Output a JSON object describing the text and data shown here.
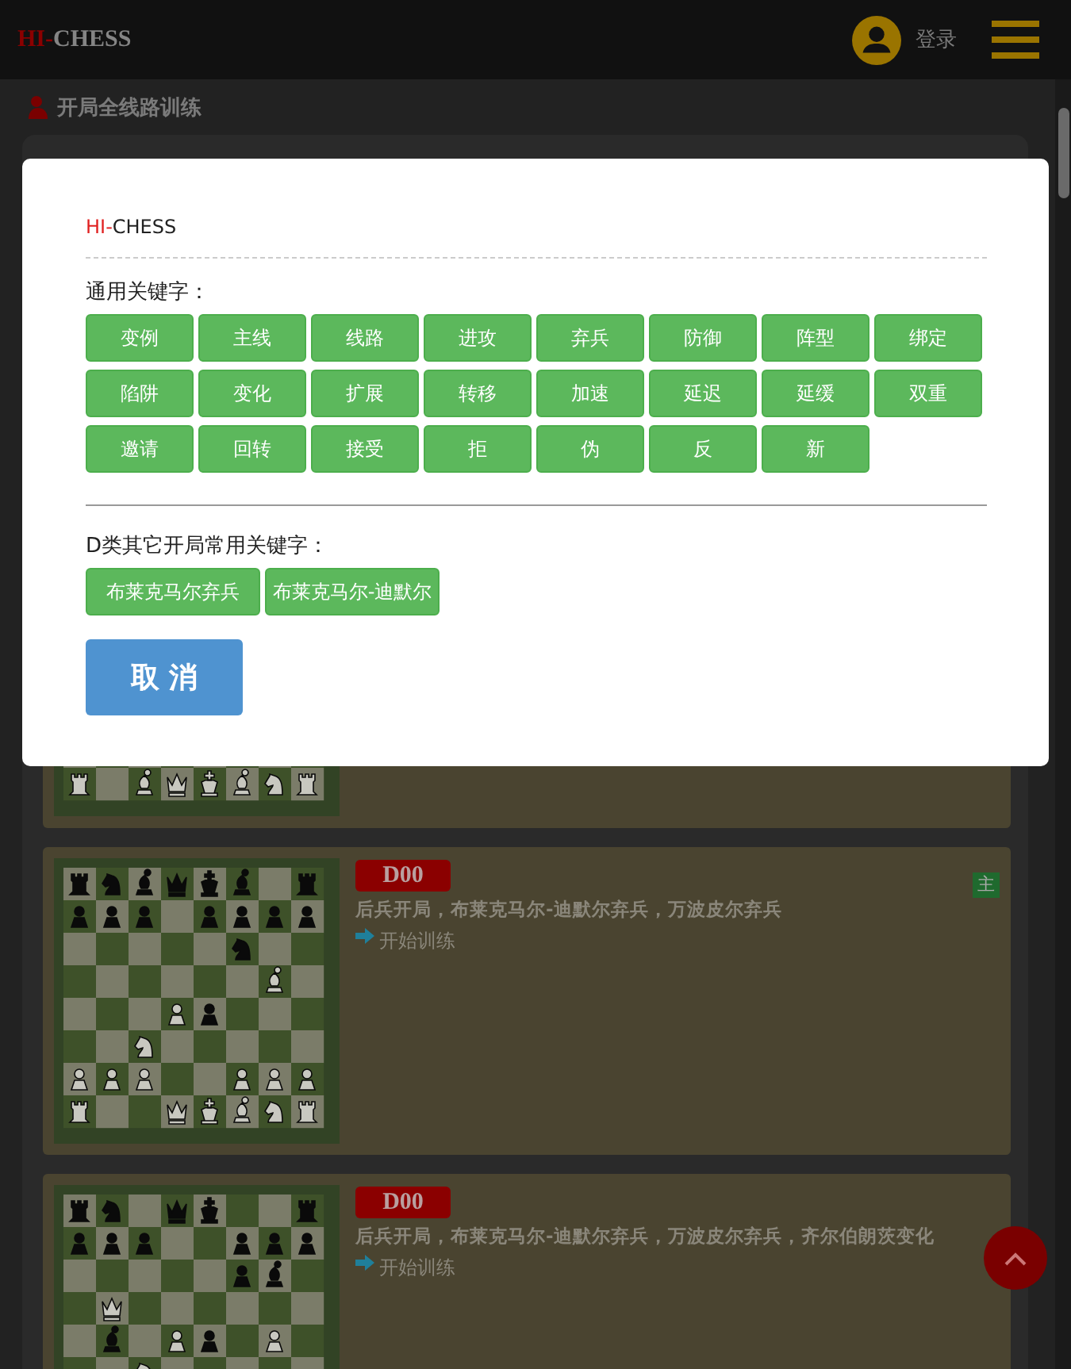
{
  "header": {
    "logo": {
      "accent": "HI-",
      "name": "CHESS"
    },
    "login": "登录"
  },
  "section_title": "开局全线路训练",
  "cards": [
    {
      "kind": "partial"
    },
    {
      "kind": "full",
      "code": "D00",
      "name": "后兵开局，布莱克马尔-迪默尔弃兵，万波皮尔弃兵",
      "action": "开始训练",
      "tag": "主"
    },
    {
      "kind": "full",
      "code": "D00",
      "name": "后兵开局，布莱克马尔-迪默尔弃兵，万波皮尔弃兵，齐尔伯朗茨变化",
      "action": "开始训练"
    }
  ],
  "dialog": {
    "brand": {
      "accent": "HI-",
      "name": "CHESS"
    },
    "general_label": "通用关键字：",
    "general_keywords": [
      "变例",
      "主线",
      "线路",
      "进攻",
      "弃兵",
      "防御",
      "阵型",
      "绑定",
      "陷阱",
      "变化",
      "扩展",
      "转移",
      "加速",
      "延迟",
      "延缓",
      "双重",
      "邀请",
      "回转",
      "接受",
      "拒",
      "伪",
      "反",
      "新"
    ],
    "specific_label": "D类其它开局常用关键字：",
    "specific_keywords": [
      "布莱克马尔弃兵",
      "布莱克马尔-迪默尔"
    ],
    "cancel": "取 消"
  }
}
